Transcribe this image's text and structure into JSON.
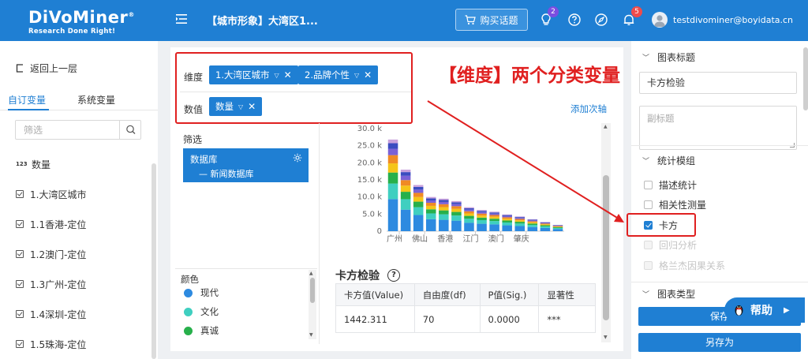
{
  "header": {
    "logo_main": "DiVoMiner",
    "logo_reg": "®",
    "logo_sub": "Research Done Right!",
    "topic_title": "【城市形象】大湾区1...",
    "buy_label": "购买话题",
    "bulb_badge": "2",
    "bell_badge": "5",
    "user_email": "testdivominer@boyidata.cn",
    "accent_color": "#1f7fd3"
  },
  "sidebar": {
    "back_label": "返回上一层",
    "tabs": [
      {
        "label": "自订变量",
        "active": true
      },
      {
        "label": "系统变量",
        "active": false
      }
    ],
    "search_placeholder": "筛选",
    "num_icon_label": "123",
    "items": [
      {
        "label": "数量",
        "icon": "number-icon"
      },
      {
        "label": "1.大湾区城市",
        "icon": "checkbox-list-icon"
      },
      {
        "label": "1.1香港-定位",
        "icon": "checkbox-list-icon"
      },
      {
        "label": "1.2澳门-定位",
        "icon": "checkbox-list-icon"
      },
      {
        "label": "1.3广州-定位",
        "icon": "checkbox-list-icon"
      },
      {
        "label": "1.4深圳-定位",
        "icon": "checkbox-list-icon"
      },
      {
        "label": "1.5珠海-定位",
        "icon": "checkbox-list-icon"
      }
    ]
  },
  "builder": {
    "dimension_label": "维度",
    "value_label": "数值",
    "dimension_chips": [
      "1.大湾区城市",
      "2.品牌个性"
    ],
    "value_chips": [
      "数量"
    ],
    "add_axis_label": "添加次轴",
    "annotation": "【维度】两个分类变量"
  },
  "filter": {
    "label": "筛选",
    "db_label": "数据库",
    "db_child": "— 新闻数据库"
  },
  "legend": {
    "label": "颜色",
    "items": [
      {
        "label": "现代",
        "color": "#2d8ae0"
      },
      {
        "label": "文化",
        "color": "#3fcfc0"
      },
      {
        "label": "真诚",
        "color": "#27b04b"
      }
    ]
  },
  "chart_data": {
    "type": "bar",
    "stacked": true,
    "categories": [
      "广州",
      "佛山",
      "香港",
      "江门",
      "澳门",
      "肇庆"
    ],
    "bar_count": 14,
    "labeled_categories_every": 2,
    "ylim": [
      0,
      30000
    ],
    "y_ticks": [
      "0",
      "5.0 k",
      "10.0 k",
      "15.0 k",
      "20.0 k",
      "25.0 k",
      "30.0 k"
    ],
    "totals": [
      26800,
      18000,
      13500,
      10000,
      9500,
      8800,
      7000,
      6200,
      5700,
      4900,
      4300,
      3500,
      2700,
      1800
    ],
    "segment_colors": [
      "#2d8ae0",
      "#3fcfc0",
      "#27b04b",
      "#f5c518",
      "#f08a24",
      "#7b61d6",
      "#3b4cc0",
      "#c9a0dc"
    ],
    "segment_shares": [
      0.35,
      0.17,
      0.12,
      0.1,
      0.09,
      0.07,
      0.06,
      0.04
    ]
  },
  "chi_square": {
    "title": "卡方检验",
    "headers": [
      "卡方值(Value)",
      "自由度(df)",
      "P值(Sig.)",
      "显著性"
    ],
    "row": [
      "1442.311",
      "70",
      "0.0000",
      "***"
    ]
  },
  "right_panel": {
    "chart_title_section": "图表标题",
    "title_value": "卡方检验",
    "subtitle_placeholder": "副标题",
    "stats_section": "统计模组",
    "options": [
      {
        "label": "描述统计",
        "checked": false,
        "disabled": false
      },
      {
        "label": "相关性测量",
        "checked": false,
        "disabled": false
      },
      {
        "label": "卡方",
        "checked": true,
        "disabled": false
      },
      {
        "label": "回归分析",
        "checked": false,
        "disabled": true
      },
      {
        "label": "格兰杰因果关系",
        "checked": false,
        "disabled": true
      }
    ],
    "chart_type_section": "图表类型",
    "save_label": "保存",
    "saveas_label": "另存为",
    "help_label": "帮助"
  }
}
